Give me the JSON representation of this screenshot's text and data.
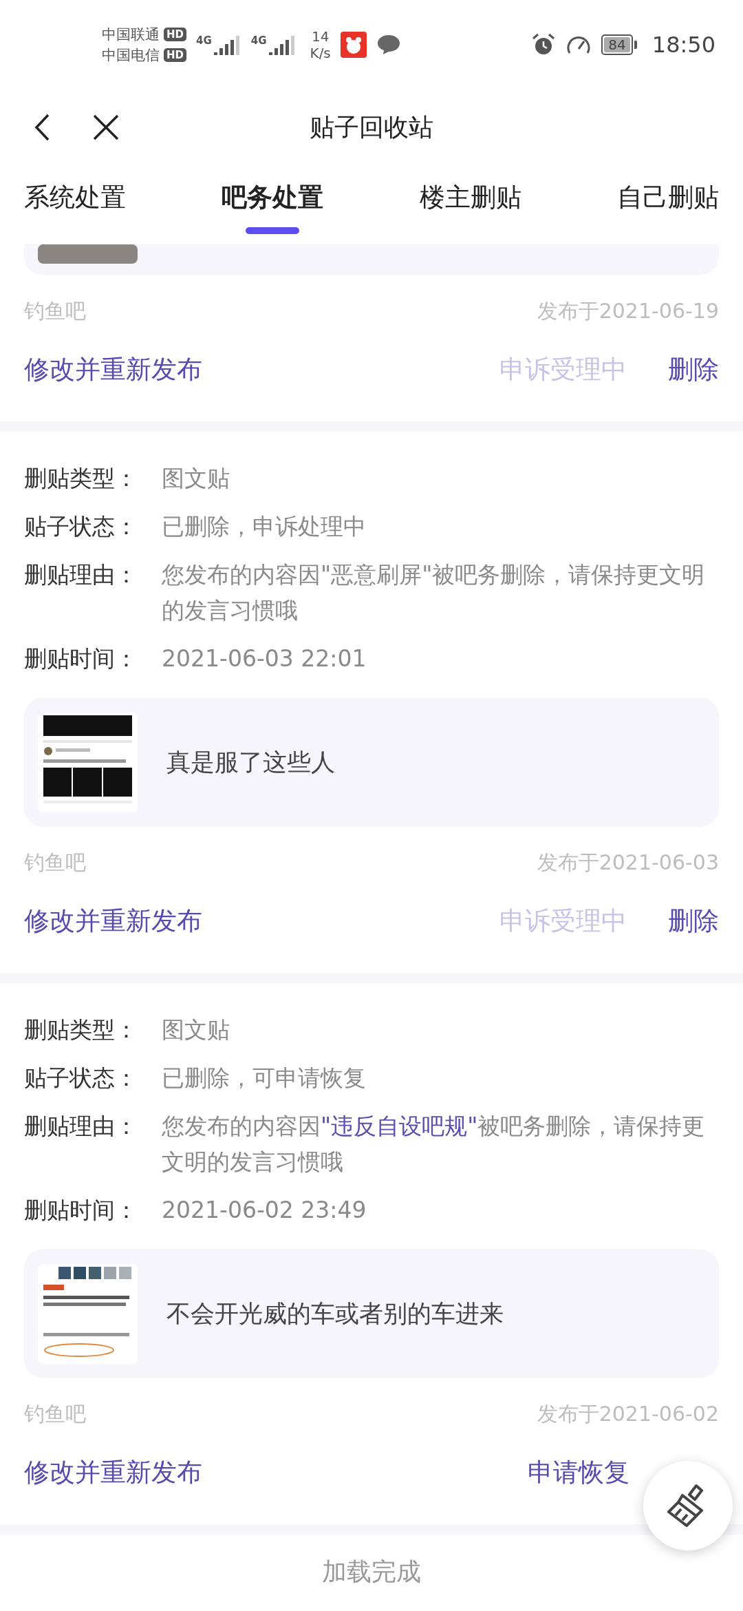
{
  "status_bar": {
    "carriers": [
      {
        "name": "中国联通",
        "badge": "HD"
      },
      {
        "name": "中国电信",
        "badge": "HD"
      }
    ],
    "networks": [
      {
        "label": "4G"
      },
      {
        "label": "4G"
      }
    ],
    "speed_value": "14",
    "speed_unit": "K/s",
    "battery": "84",
    "time": "18:50"
  },
  "header": {
    "title": "贴子回收站"
  },
  "tabs": [
    {
      "label": "系统处置",
      "selected": false
    },
    {
      "label": "吧务处置",
      "selected": true
    },
    {
      "label": "楼主删贴",
      "selected": false
    },
    {
      "label": "自己删贴",
      "selected": false
    }
  ],
  "posts": [
    {
      "card": {
        "partial": true
      },
      "forum": "钓鱼吧",
      "published": "发布于2021-06-19",
      "actions": [
        {
          "label": "修改并重新发布",
          "disabled": false
        },
        {
          "label": "申诉受理中",
          "disabled": true
        },
        {
          "label": "删除",
          "disabled": false
        }
      ]
    },
    {
      "fields": [
        {
          "label": "删贴类型：",
          "value": [
            {
              "text": "图文贴",
              "highlight": false
            }
          ]
        },
        {
          "label": "贴子状态：",
          "value": [
            {
              "text": "已删除，申诉处理中",
              "highlight": false
            }
          ]
        },
        {
          "label": "删贴理由：",
          "value": [
            {
              "text": "您发布的内容因\"恶意刷屏\"被吧务删除，请保持更文明的发言习惯哦",
              "highlight": false
            }
          ]
        },
        {
          "label": "删贴时间：",
          "value": [
            {
              "text": "2021-06-03 22:01",
              "highlight": false
            }
          ]
        }
      ],
      "card": {
        "title": "真是服了这些人",
        "partial": false
      },
      "forum": "钓鱼吧",
      "published": "发布于2021-06-03",
      "actions": [
        {
          "label": "修改并重新发布",
          "disabled": false
        },
        {
          "label": "申诉受理中",
          "disabled": true
        },
        {
          "label": "删除",
          "disabled": false
        }
      ]
    },
    {
      "fields": [
        {
          "label": "删贴类型：",
          "value": [
            {
              "text": "图文贴",
              "highlight": false
            }
          ]
        },
        {
          "label": "贴子状态：",
          "value": [
            {
              "text": "已删除，可申请恢复",
              "highlight": false
            }
          ]
        },
        {
          "label": "删贴理由：",
          "value": [
            {
              "text": "您发布的内容因",
              "highlight": false
            },
            {
              "text": "\"违反自设吧规\"",
              "highlight": true
            },
            {
              "text": "被吧务删除，请保持更文明的发言习惯哦",
              "highlight": false
            }
          ]
        },
        {
          "label": "删贴时间：",
          "value": [
            {
              "text": "2021-06-02 23:49",
              "highlight": false
            }
          ]
        }
      ],
      "card": {
        "title": "不会开光威的车或者别的车进来",
        "partial": false
      },
      "forum": "钓鱼吧",
      "published": "发布于2021-06-02",
      "actions": [
        {
          "label": "修改并重新发布",
          "disabled": false
        },
        {
          "label": "申请恢复",
          "disabled": false
        }
      ]
    }
  ],
  "footer": {
    "text": "加载完成"
  },
  "floating_button": {
    "kind": "broom"
  }
}
